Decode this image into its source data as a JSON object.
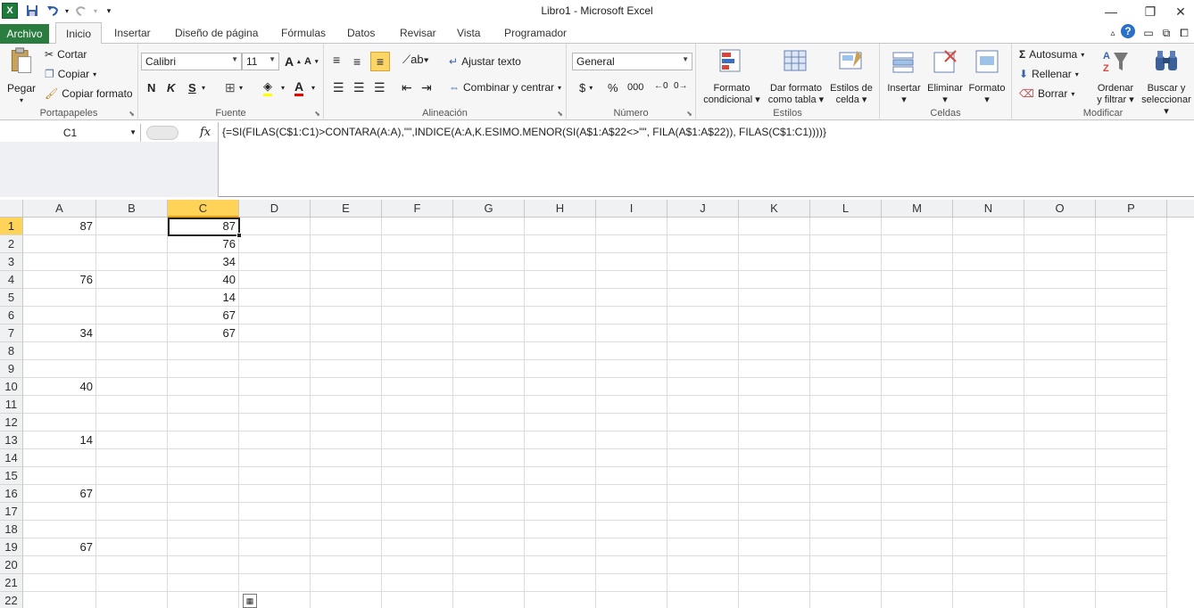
{
  "window": {
    "title": "Libro1  -  Microsoft Excel",
    "app_icon": "X"
  },
  "tabs": [
    "Archivo",
    "Inicio",
    "Insertar",
    "Diseño de página",
    "Fórmulas",
    "Datos",
    "Revisar",
    "Vista",
    "Programador"
  ],
  "ribbon": {
    "portapapeles": {
      "label": "Portapapeles",
      "pegar": "Pegar",
      "cortar": "Cortar",
      "copiar": "Copiar",
      "copiar_formato": "Copiar formato"
    },
    "fuente": {
      "label": "Fuente",
      "font": "Calibri",
      "size": "11",
      "bold": "N",
      "italic": "K",
      "underline": "S"
    },
    "alineacion": {
      "label": "Alineación",
      "ajustar": "Ajustar texto",
      "combinar": "Combinar y centrar"
    },
    "numero": {
      "label": "Número",
      "format": "General",
      "currency": "$",
      "percent": "%",
      "thousands": "000"
    },
    "estilos": {
      "label": "Estilos",
      "formato_cond_1": "Formato",
      "formato_cond_2": "condicional",
      "dar_formato_1": "Dar formato",
      "dar_formato_2": "como tabla",
      "estilos_celda_1": "Estilos de",
      "estilos_celda_2": "celda"
    },
    "celdas": {
      "label": "Celdas",
      "insertar": "Insertar",
      "eliminar": "Eliminar",
      "formato": "Formato"
    },
    "modificar": {
      "label": "Modificar",
      "autosuma": "Autosuma",
      "rellenar": "Rellenar",
      "borrar": "Borrar",
      "ordenar_1": "Ordenar",
      "ordenar_2": "y filtrar",
      "buscar_1": "Buscar y",
      "buscar_2": "seleccionar"
    }
  },
  "formula_bar": {
    "name_box": "C1",
    "fx": "fx",
    "formula": "{=SI(FILAS(C$1:C1)>CONTARA(A:A),\"\",INDICE(A:A,K.ESIMO.MENOR(SI(A$1:A$22<>\"\", FILA(A$1:A$22)), FILAS(C$1:C1))))}"
  },
  "columns": [
    "A",
    "B",
    "C",
    "D",
    "E",
    "F",
    "G",
    "H",
    "I",
    "J",
    "K",
    "L",
    "M",
    "N",
    "O",
    "P"
  ],
  "selected_column": "C",
  "selected_row": 1,
  "rows": [
    {
      "n": "1",
      "A": "87",
      "C": "87"
    },
    {
      "n": "2",
      "A": "",
      "C": "76"
    },
    {
      "n": "3",
      "A": "",
      "C": "34"
    },
    {
      "n": "4",
      "A": "76",
      "C": "40"
    },
    {
      "n": "5",
      "A": "",
      "C": "14"
    },
    {
      "n": "6",
      "A": "",
      "C": "67"
    },
    {
      "n": "7",
      "A": "34",
      "C": "67"
    },
    {
      "n": "8",
      "A": "",
      "C": ""
    },
    {
      "n": "9",
      "A": "",
      "C": ""
    },
    {
      "n": "10",
      "A": "40",
      "C": ""
    },
    {
      "n": "11",
      "A": "",
      "C": ""
    },
    {
      "n": "12",
      "A": "",
      "C": ""
    },
    {
      "n": "13",
      "A": "14",
      "C": ""
    },
    {
      "n": "14",
      "A": "",
      "C": ""
    },
    {
      "n": "15",
      "A": "",
      "C": ""
    },
    {
      "n": "16",
      "A": "67",
      "C": ""
    },
    {
      "n": "17",
      "A": "",
      "C": ""
    },
    {
      "n": "18",
      "A": "",
      "C": ""
    },
    {
      "n": "19",
      "A": "67",
      "C": ""
    },
    {
      "n": "20",
      "A": "",
      "C": ""
    },
    {
      "n": "21",
      "A": "",
      "C": ""
    },
    {
      "n": "22",
      "A": "",
      "C": ""
    }
  ]
}
